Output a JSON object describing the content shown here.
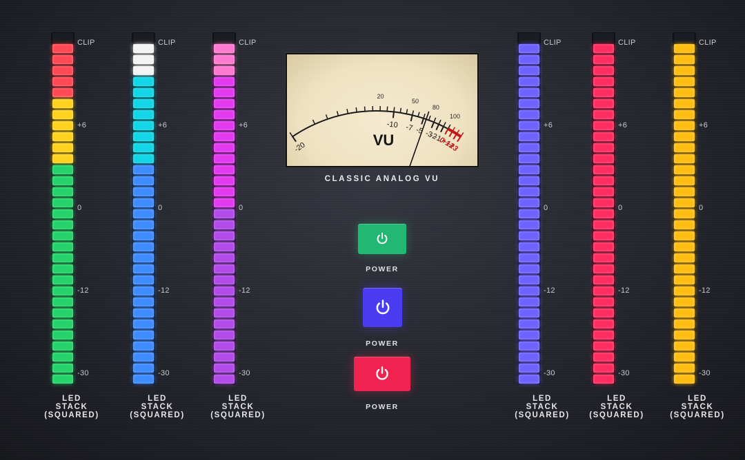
{
  "meters": [
    {
      "id": "m1",
      "label_lines": [
        "LED",
        "STACK",
        "(SQUARED)"
      ],
      "palette": "classic",
      "level": 1.0
    },
    {
      "id": "m2",
      "label_lines": [
        "LED",
        "STACK",
        "(SQUARED)"
      ],
      "palette": "cyan-blue",
      "level": 1.0
    },
    {
      "id": "m3",
      "label_lines": [
        "LED",
        "STACK",
        "(SQUARED)"
      ],
      "palette": "magenta-violet",
      "level": 1.0
    },
    {
      "id": "m4",
      "label_lines": [
        "LED",
        "STACK",
        "(SQUARED)"
      ],
      "palette": "indigo",
      "level": 1.0
    },
    {
      "id": "m5",
      "label_lines": [
        "LED",
        "STACK",
        "(SQUARED)"
      ],
      "palette": "crimson",
      "level": 1.0
    },
    {
      "id": "m6",
      "label_lines": [
        "LED",
        "STACK",
        "(SQUARED)"
      ],
      "palette": "amber",
      "level": 1.0
    }
  ],
  "scale_labels": {
    "clip": "CLIP",
    "plus6": "+6",
    "zero": "0",
    "minus12": "-12",
    "minus30": "-30"
  },
  "vu": {
    "title": "VU",
    "caption": "CLASSIC ANALOG VU",
    "db_labels": [
      "-20",
      "-10",
      "-7",
      "-5",
      "-3",
      "-2",
      "-1",
      "0",
      "+1",
      "+2",
      "+3"
    ],
    "percent_labels": [
      "20",
      "50",
      "80",
      "100"
    ],
    "needle_db": -4.5
  },
  "power_buttons": [
    {
      "id": "p1",
      "label": "POWER",
      "color": "#22b873"
    },
    {
      "id": "p2",
      "label": "POWER",
      "color": "#4a3cf0"
    },
    {
      "id": "p3",
      "label": "POWER",
      "color": "#f0224f"
    }
  ],
  "colors": {
    "classic_red": "#ff4a55",
    "classic_yellow": "#ffd21f",
    "classic_green": "#26d36a",
    "cyan": "#12d6e6",
    "blue": "#3e8cff",
    "white": "#f4f4f4",
    "pink": "#ff7ad0",
    "magenta": "#e33af0",
    "violet": "#b14ce8",
    "indigo": "#6f63ff",
    "crimson": "#ff2e62",
    "amber": "#ffbe14"
  }
}
